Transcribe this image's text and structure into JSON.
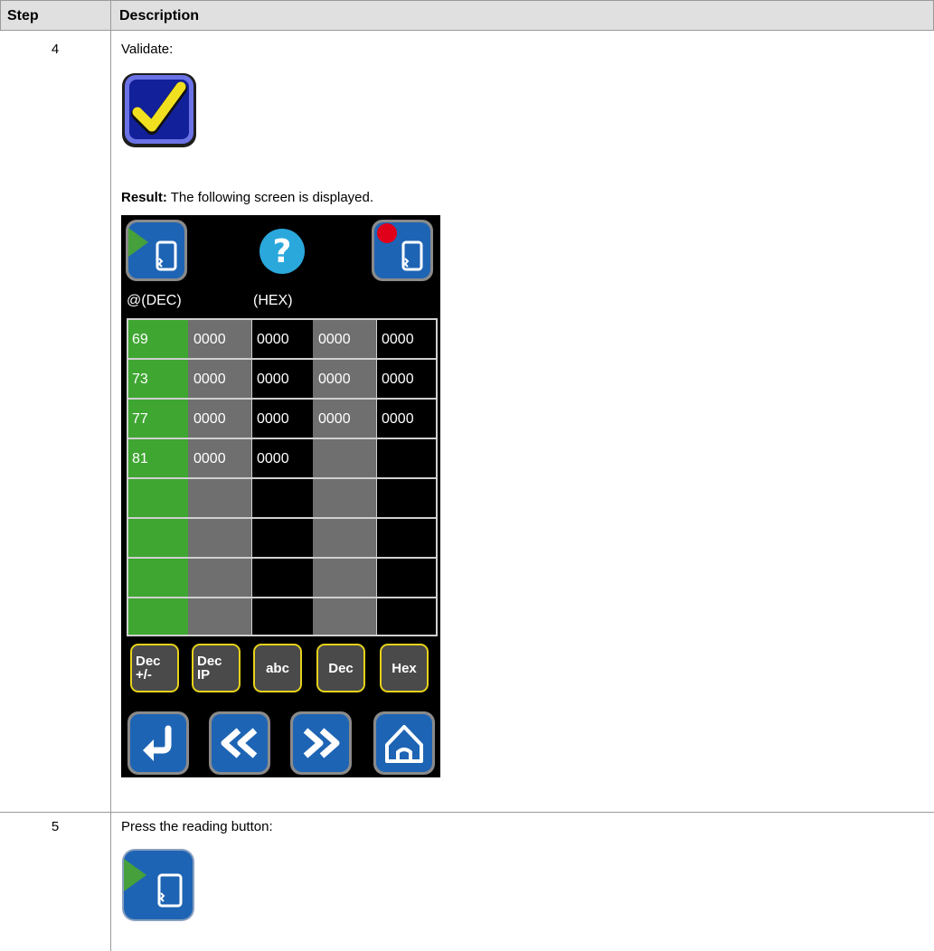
{
  "table": {
    "header": {
      "step": "Step",
      "description": "Description"
    },
    "rows": [
      {
        "step": "4",
        "instruction": "Validate:",
        "result_label": "Result:",
        "result_text": " The following screen is displayed."
      },
      {
        "step": "5",
        "instruction": "Press the reading button:"
      }
    ]
  },
  "device_screen": {
    "address_label": "@(DEC)",
    "value_label": "(HEX)",
    "rows": [
      [
        "69",
        "0000",
        "0000",
        "0000",
        "0000"
      ],
      [
        "73",
        "0000",
        "0000",
        "0000",
        "0000"
      ],
      [
        "77",
        "0000",
        "0000",
        "0000",
        "0000"
      ],
      [
        "81",
        "0000",
        "0000",
        "",
        ""
      ],
      [
        "",
        "",
        "",
        "",
        ""
      ],
      [
        "",
        "",
        "",
        "",
        ""
      ],
      [
        "",
        "",
        "",
        "",
        ""
      ],
      [
        "",
        "",
        "",
        "",
        ""
      ]
    ],
    "format_buttons": [
      {
        "line1": "Dec",
        "line2": "+/-"
      },
      {
        "line1": "Dec",
        "line2": "IP"
      },
      {
        "line1": "abc",
        "line2": ""
      },
      {
        "line1": "Dec",
        "line2": ""
      },
      {
        "line1": "Hex",
        "line2": ""
      }
    ],
    "icons": {
      "read": "read-icon",
      "help": "help-icon",
      "write": "write-icon",
      "back": "back-icon",
      "previous": "previous-page-icon",
      "next": "next-page-icon",
      "home": "home-icon"
    }
  },
  "colors": {
    "address_column": "#3fa632",
    "gray_column": "#6f6f6f",
    "button_blue": "#1e64b4",
    "validate_yellow": "#f0e020",
    "format_border": "#e6d21a",
    "read_arrow": "#46a03c",
    "write_dot": "#e0001a"
  }
}
